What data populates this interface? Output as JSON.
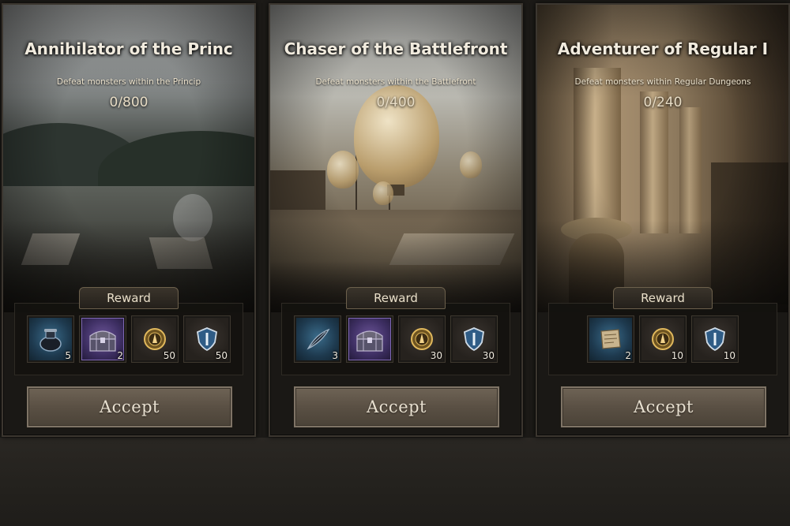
{
  "cards": [
    {
      "title": "Annihilator of the Princ",
      "description": "Defeat monsters within the Princip",
      "progress": "0/800",
      "reward_label": "Reward",
      "rewards": [
        {
          "icon": "ink-pot-icon",
          "rarity": "blue",
          "count": "5"
        },
        {
          "icon": "treasure-chest-icon",
          "rarity": "purple",
          "count": "2"
        },
        {
          "icon": "gold-emblem-icon",
          "rarity": "dark",
          "count": "50"
        },
        {
          "icon": "blue-shield-crest-icon",
          "rarity": "dark",
          "count": "50"
        }
      ],
      "accept_label": "Accept"
    },
    {
      "title": "Chaser of the Battlefront",
      "description": "Defeat monsters within the Battlefront",
      "progress": "0/400",
      "reward_label": "Reward",
      "rewards": [
        {
          "icon": "quill-feather-icon",
          "rarity": "blue",
          "count": "3"
        },
        {
          "icon": "treasure-chest-icon",
          "rarity": "purple",
          "count": ""
        },
        {
          "icon": "gold-emblem-icon",
          "rarity": "dark",
          "count": "30"
        },
        {
          "icon": "blue-shield-crest-icon",
          "rarity": "dark",
          "count": "30"
        }
      ],
      "accept_label": "Accept"
    },
    {
      "title": "Adventurer of Regular I",
      "description": "Defeat monsters within Regular Dungeons",
      "progress": "0/240",
      "reward_label": "Reward",
      "rewards": [
        {
          "icon": "scroll-map-icon",
          "rarity": "blue",
          "count": "2"
        },
        {
          "icon": "gold-emblem-icon",
          "rarity": "dark",
          "count": "10"
        },
        {
          "icon": "blue-shield-crest-icon",
          "rarity": "dark",
          "count": "10"
        }
      ],
      "accept_label": "Accept"
    }
  ]
}
